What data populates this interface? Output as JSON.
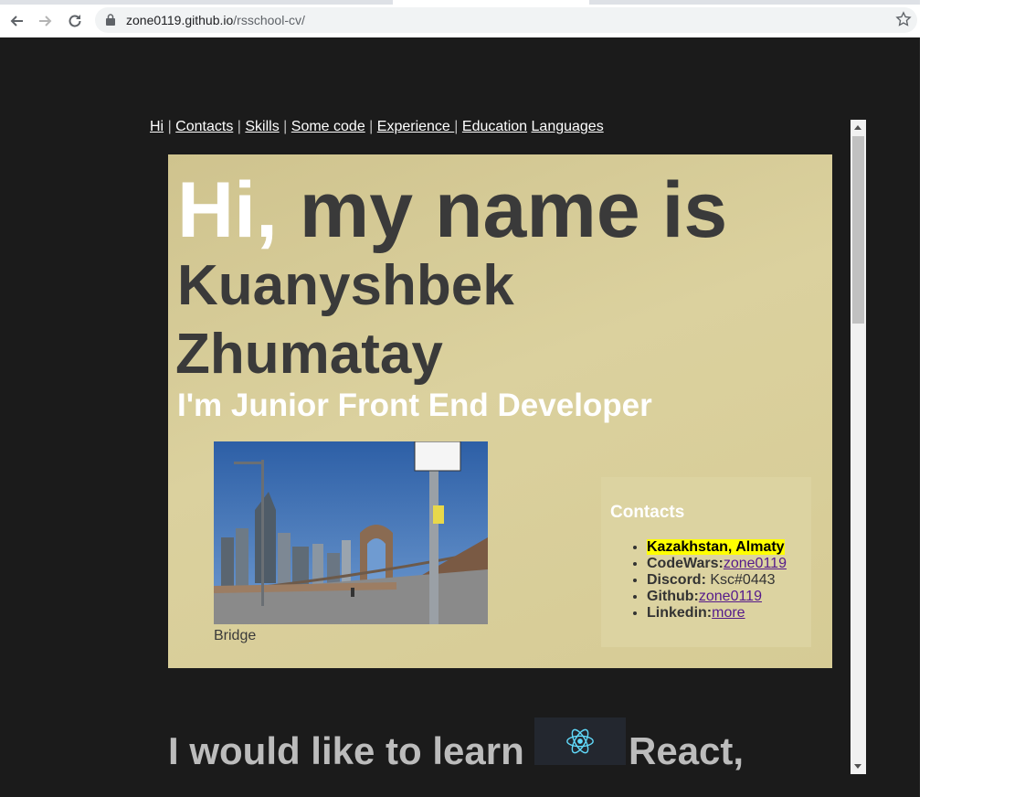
{
  "browser": {
    "url_host": "zone0119.github.io",
    "url_path": "/rsschool-cv/"
  },
  "nav": {
    "items": [
      "Hi",
      "Contacts",
      "Skills",
      "Some code",
      "Experience ",
      "Education",
      "Languages"
    ],
    "separator": "|"
  },
  "hero": {
    "hi": "Hi,",
    "intro": " my name is",
    "first_name": "Kuanyshbek",
    "last_name": "Zhumatay",
    "role": "I'm Junior Front End Developer",
    "photo_caption": "Bridge"
  },
  "contacts": {
    "title": "Contacts",
    "location": "Kazakhstan, Almaty",
    "codewars_label": "CodeWars:",
    "codewars_link": "zone0119",
    "discord_label": "Discord:",
    "discord_value": " Ksc#0443",
    "github_label": "Github:",
    "github_link": "zone0119",
    "linkedin_label": "Linkedin:",
    "linkedin_link": "more"
  },
  "learn": {
    "text": "I would like to learn",
    "tech": "React,"
  },
  "colors": {
    "page_bg": "#1b1b1b",
    "hero_bg": "#d6cb95",
    "react_blue": "#61dafb",
    "highlight": "#ffff00"
  }
}
